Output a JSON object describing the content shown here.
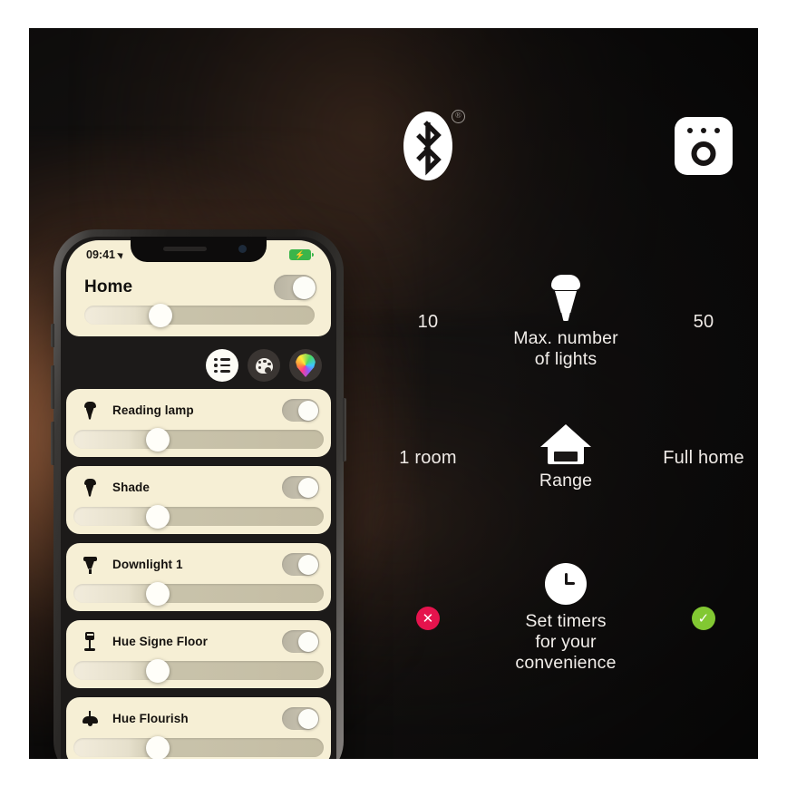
{
  "meta": {
    "scene": "philips-hue-bluetooth-vs-bridge-comparison"
  },
  "header": {
    "left_icon": "bluetooth-logo-icon",
    "left_icon_mark": "®",
    "right_icon": "hue-bridge-icon"
  },
  "comparison": {
    "rows": [
      {
        "id": "max-lights",
        "icon": "light-bulb-icon",
        "label": "Max. number\nof lights",
        "label_line1": "Max. number",
        "label_line2": "of lights",
        "left_value": "10",
        "right_value": "50"
      },
      {
        "id": "range",
        "icon": "house-icon",
        "label": "Range",
        "left_value": "1 room",
        "right_value": "Full home"
      },
      {
        "id": "timers",
        "icon": "clock-icon",
        "label_line1": "Set timers",
        "label_line2": "for your",
        "label_line3": "convenience",
        "left_value": "✕",
        "right_value": "✓",
        "left_badge": "cross-badge",
        "right_badge": "check-badge"
      }
    ]
  },
  "phone": {
    "status_bar": {
      "time": "09:41",
      "location_icon": "location-arrow-icon",
      "battery_icon": "battery-charging-icon"
    },
    "app": {
      "title": "Home",
      "master_toggle_state": "on",
      "master_brightness_percent": 33,
      "tabs": [
        {
          "id": "list",
          "icon": "list-icon",
          "active": true
        },
        {
          "id": "scenes",
          "icon": "palette-icon",
          "active": false
        },
        {
          "id": "colors",
          "icon": "color-pin-icon",
          "active": false
        }
      ],
      "lights": [
        {
          "name": "Reading lamp",
          "icon": "spot-bulb-icon",
          "toggle": "on",
          "brightness_percent": 34
        },
        {
          "name": "Shade",
          "icon": "spot-bulb-icon",
          "toggle": "on",
          "brightness_percent": 34
        },
        {
          "name": "Downlight 1",
          "icon": "downlight-icon",
          "toggle": "on",
          "brightness_percent": 34
        },
        {
          "name": "Hue Signe Floor",
          "icon": "floor-lamp-icon",
          "toggle": "on",
          "brightness_percent": 34
        },
        {
          "name": "Hue Flourish",
          "icon": "pendant-lamp-icon",
          "toggle": "on",
          "brightness_percent": 34
        }
      ]
    }
  },
  "colors": {
    "accent_cream": "#f6efd5",
    "badge_cross": "#e5134d",
    "badge_check": "#82c832",
    "background_dark": "#141211",
    "glow_warm": "#c47c50",
    "battery_green": "#3bb54a"
  }
}
